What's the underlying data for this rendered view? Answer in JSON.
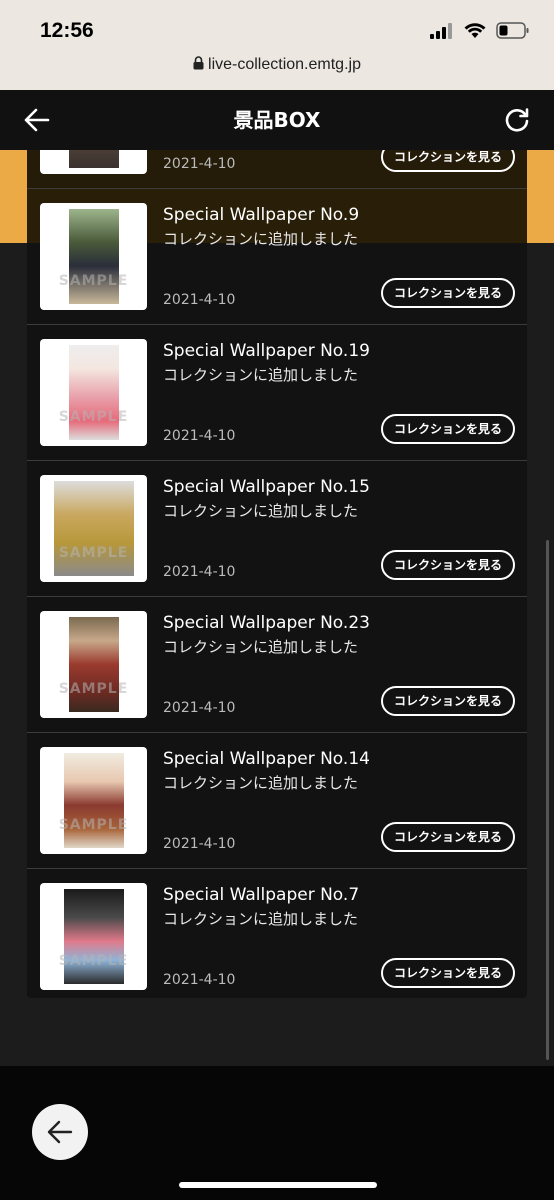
{
  "status": {
    "time": "12:56"
  },
  "browser": {
    "url": "live-collection.emtg.jp"
  },
  "header": {
    "title": "景品BOX"
  },
  "items": [
    {
      "title": "",
      "subtitle": "",
      "date": "2021-4-10",
      "button": "コレクションを見る",
      "photo_color": "#5a4a3a"
    },
    {
      "title": "Special Wallpaper No.9",
      "subtitle": "コレクションに追加しました",
      "date": "2021-4-10",
      "button": "コレクションを見る",
      "watermark": "SAMPLE",
      "photo_color": "#6b7a5a"
    },
    {
      "title": "Special Wallpaper No.19",
      "subtitle": "コレクションに追加しました",
      "date": "2021-4-10",
      "button": "コレクションを見る",
      "watermark": "SAMPLE",
      "photo_color": "#d9a0a6"
    },
    {
      "title": "Special Wallpaper No.15",
      "subtitle": "コレクションに追加しました",
      "date": "2021-4-10",
      "button": "コレクションを見る",
      "watermark": "SAMPLE",
      "photo_color": "#b8983a"
    },
    {
      "title": "Special Wallpaper No.23",
      "subtitle": "コレクションに追加しました",
      "date": "2021-4-10",
      "button": "コレクションを見る",
      "watermark": "SAMPLE",
      "photo_color": "#9a3a2e"
    },
    {
      "title": "Special Wallpaper No.14",
      "subtitle": "コレクションに追加しました",
      "date": "2021-4-10",
      "button": "コレクションを見る",
      "watermark": "SAMPLE",
      "photo_color": "#a8643a"
    },
    {
      "title": "Special Wallpaper No.7",
      "subtitle": "コレクションに追加しました",
      "date": "2021-4-10",
      "button": "コレクションを見る",
      "watermark": "SAMPLE",
      "photo_color": "#8fb4d8"
    }
  ],
  "colors": {
    "accent": "#ecaa46",
    "header_bg": "#111111",
    "list_bg": "#121212"
  },
  "icons": {
    "back": "arrow-left-icon",
    "reload": "reload-icon",
    "fab": "arrow-left-icon"
  }
}
